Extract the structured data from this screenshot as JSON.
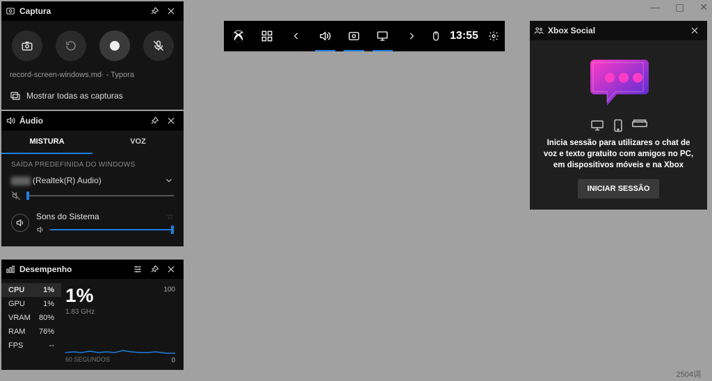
{
  "captura": {
    "title": "Captura",
    "subtitle": "record-screen-windows.md· - Typora",
    "show_all": "Mostrar todas as capturas"
  },
  "audio": {
    "title": "Áudio",
    "tabs": {
      "mix": "MISTURA",
      "voice": "VOZ"
    },
    "output_label": "SAÍDA PREDEFINIDA DO WINDOWS",
    "device": "(Realtek(R) Audio)",
    "device_masked": "▇▇▇",
    "system_sounds": "Sons do Sistema",
    "mic_level": 0,
    "sys_level": 100
  },
  "perf": {
    "title": "Desempenho",
    "items": [
      {
        "label": "CPU",
        "value": "1%"
      },
      {
        "label": "GPU",
        "value": "1%"
      },
      {
        "label": "VRAM",
        "value": "80%"
      },
      {
        "label": "RAM",
        "value": "76%"
      },
      {
        "label": "FPS",
        "value": "--"
      }
    ],
    "big_value": "1%",
    "freq": "1.83 GHz",
    "ymax": "100",
    "ymin": "0",
    "xlabel": "60 SEGUNDOS"
  },
  "topbar": {
    "time": "13:55"
  },
  "social": {
    "title": "Xbox Social",
    "message": "Inicia sessão para utilizares o chat de voz e texto gratuito com amigos no PC, em dispositivos móveis e na Xbox",
    "signin": "INICIAR SESSÃO"
  },
  "status": {
    "chars": "2504词"
  },
  "chart_data": {
    "type": "line",
    "title": "CPU",
    "xlabel": "60 SEGUNDOS",
    "ylabel": "%",
    "ylim": [
      0,
      100
    ],
    "x_seconds_ago": [
      60,
      55,
      50,
      45,
      40,
      35,
      30,
      25,
      20,
      15,
      10,
      5,
      0
    ],
    "values": [
      2,
      3,
      2,
      4,
      2,
      3,
      2,
      5,
      3,
      2,
      2,
      3,
      1
    ]
  }
}
